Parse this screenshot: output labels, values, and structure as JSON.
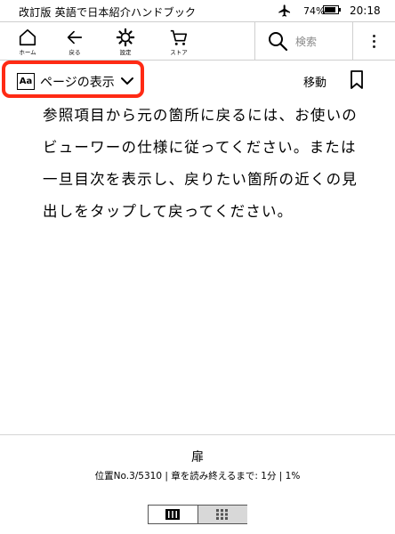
{
  "status": {
    "book_title": "改訂版 英語で日本紹介ハンドブック",
    "battery": "74%",
    "time": "20:18"
  },
  "toolbar": {
    "home_label": "ホーム",
    "back_label": "戻る",
    "settings_label": "設定",
    "store_label": "ストア",
    "search_placeholder": "検索"
  },
  "subbar": {
    "aa": "Aa",
    "display_label": "ページの表示",
    "move_label": "移動"
  },
  "content": {
    "lines": [
      "参照項目から元の箇所に戻るには、お使いの",
      "ビューワーの仕様に従ってください。または",
      "一旦目次を表示し、戻りたい箇所の近くの見",
      "出しをタップして戻ってください。"
    ]
  },
  "footer": {
    "chapter": "扉",
    "progress": "位置No.3/5310 | 章を読み終えるまで: 1分 | 1%"
  },
  "colors": {
    "highlight": "#ff2a14"
  }
}
